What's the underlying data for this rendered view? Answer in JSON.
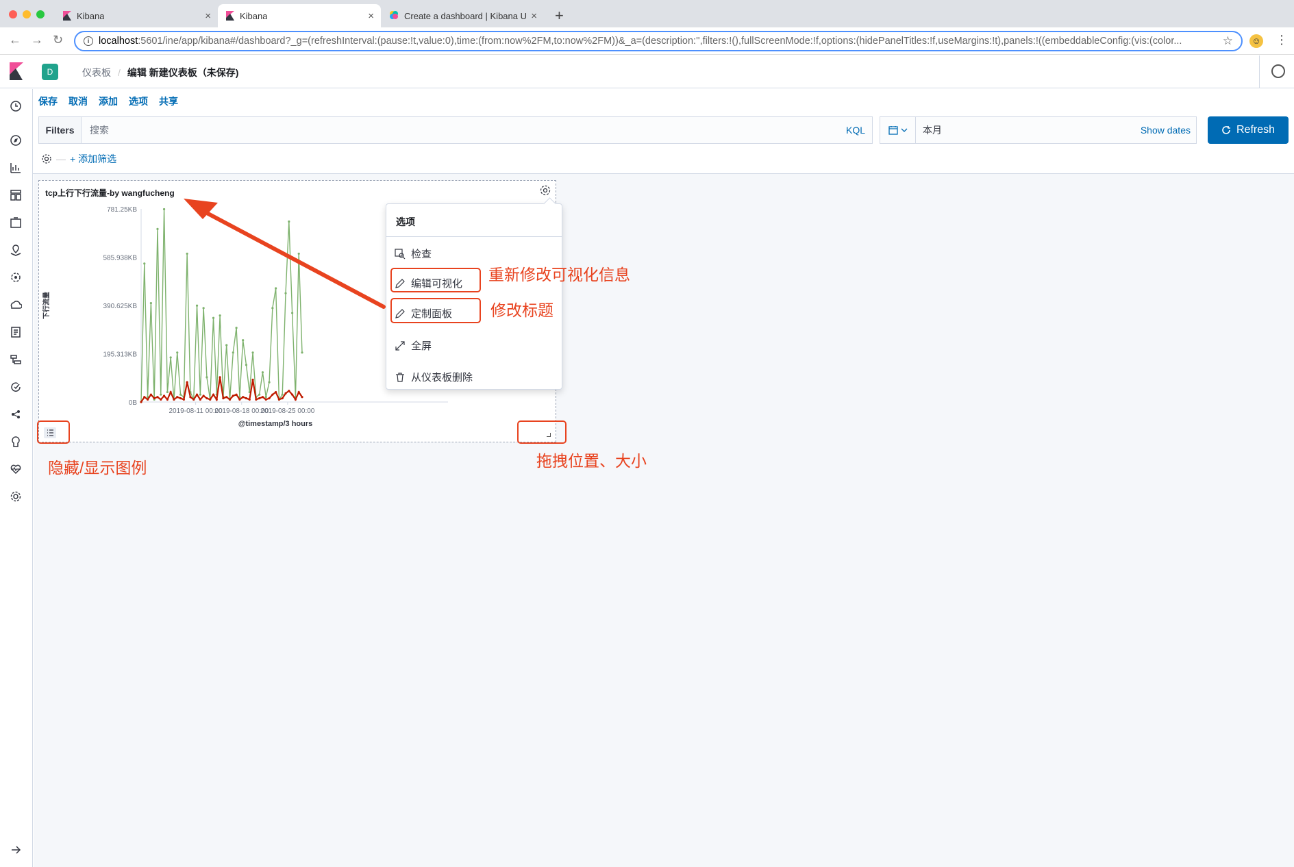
{
  "browser": {
    "tabs": [
      {
        "title": "Kibana",
        "active": false
      },
      {
        "title": "Kibana",
        "active": true
      },
      {
        "title": "Create a dashboard | Kibana U",
        "active": false
      }
    ],
    "url_host": "localhost",
    "url_rest": ":5601/ine/app/kibana#/dashboard?_g=(refreshInterval:(pause:!t,value:0),time:(from:now%2FM,to:now%2FM))&_a=(description:'',filters:!(),fullScreenMode:!f,options:(hidePanelTitles:!f,useMargins:!t),panels:!((embeddableConfig:(vis:(color..."
  },
  "header": {
    "space_initial": "D",
    "breadcrumb_parent": "仪表板",
    "breadcrumb_current": "编辑 新建仪表板（未保存)"
  },
  "top_menu": {
    "save": "保存",
    "cancel": "取消",
    "add": "添加",
    "options": "选项",
    "share": "共享"
  },
  "query_bar": {
    "filters_label": "Filters",
    "search_placeholder": "搜索",
    "kql": "KQL",
    "date_value": "本月",
    "show_dates": "Show dates",
    "refresh": "Refresh",
    "add_filter": "+ 添加筛选"
  },
  "panel": {
    "title": "tcp上行下行流量-by wangfucheng"
  },
  "chart_data": {
    "type": "line",
    "ylabel": "下行流量",
    "xlabel": "@timestamp/3 hours",
    "y_ticks": [
      "781.25KB",
      "585.938KB",
      "390.625KB",
      "195.313KB",
      "0B"
    ],
    "y_tick_values": [
      781.25,
      585.938,
      390.625,
      195.313,
      0
    ],
    "ylim": [
      0,
      781.25
    ],
    "x_ticks": [
      "2019-08-11 00:00",
      "2019-08-18 00:00",
      "2019-08-25 00:00"
    ],
    "grid": false,
    "series": [
      {
        "color": "#7eb26d",
        "values": [
          0,
          560,
          20,
          400,
          10,
          700,
          30,
          780,
          40,
          180,
          10,
          200,
          30,
          20,
          600,
          40,
          10,
          390,
          30,
          380,
          100,
          10,
          340,
          30,
          350,
          20,
          230,
          10,
          200,
          300,
          20,
          250,
          150,
          40,
          200,
          20,
          30,
          120,
          20,
          80,
          380,
          460,
          10,
          30,
          440,
          730,
          360,
          20,
          600,
          200
        ],
        "x_start_days": 0,
        "x_step_days": 0.5
      },
      {
        "color": "#bf1b00",
        "values": [
          0,
          20,
          10,
          30,
          15,
          20,
          10,
          25,
          10,
          40,
          10,
          20,
          15,
          10,
          80,
          20,
          10,
          30,
          10,
          25,
          15,
          10,
          30,
          10,
          100,
          15,
          20,
          10,
          25,
          30,
          10,
          20,
          15,
          10,
          90,
          10,
          15,
          20,
          10,
          15,
          30,
          40,
          10,
          15,
          35,
          45,
          30,
          10,
          40,
          20
        ],
        "x_start_days": 0,
        "x_step_days": 0.5
      }
    ]
  },
  "popover": {
    "title": "选项",
    "items": [
      "检查",
      "编辑可视化",
      "定制面板",
      "全屏",
      "从仪表板删除"
    ]
  },
  "annotations": {
    "edit_vis": "重新修改可视化信息",
    "edit_title": "修改标题",
    "legend": "隐藏/显示图例",
    "drag": "拖拽位置、大小"
  },
  "colors": {
    "accent": "#006bb4",
    "annotation": "#e8431f",
    "space": "#20a38c"
  }
}
